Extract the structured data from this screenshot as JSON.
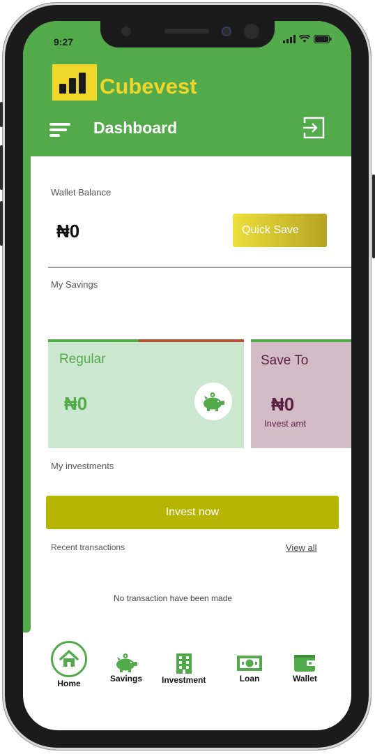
{
  "status_bar": {
    "time": "9:27"
  },
  "header": {
    "brand": "Cubevest",
    "title": "Dashboard"
  },
  "wallet": {
    "label": "Wallet Balance",
    "balance": "₦0",
    "quick_save": "Quick Save"
  },
  "savings": {
    "label": "My Savings",
    "regular": {
      "title": "Regular",
      "amount": "₦0"
    },
    "save_to": {
      "title": "Save To",
      "amount": "₦0",
      "subtitle": "Invest amt"
    }
  },
  "investments": {
    "label": "My investments",
    "invest_now": "Invest now"
  },
  "transactions": {
    "label": "Recent transactions",
    "view_all": "View all",
    "empty": "No transaction have been made"
  },
  "nav": {
    "home": "Home",
    "savings": "Savings",
    "investment": "Investment",
    "loan": "Loan",
    "wallet": "Wallet"
  },
  "colors": {
    "primary_green": "#52aa4a",
    "brand_yellow": "#f0d628",
    "invest_button": "#b6b602",
    "regular_card": "#cde8d0",
    "save_to_card": "#d2bcc6",
    "save_to_text": "#5c2142"
  },
  "icons": [
    "menu-icon",
    "logout-icon",
    "piggy-bank-icon",
    "home-icon",
    "building-icon",
    "banknote-icon",
    "wallet-icon"
  ]
}
